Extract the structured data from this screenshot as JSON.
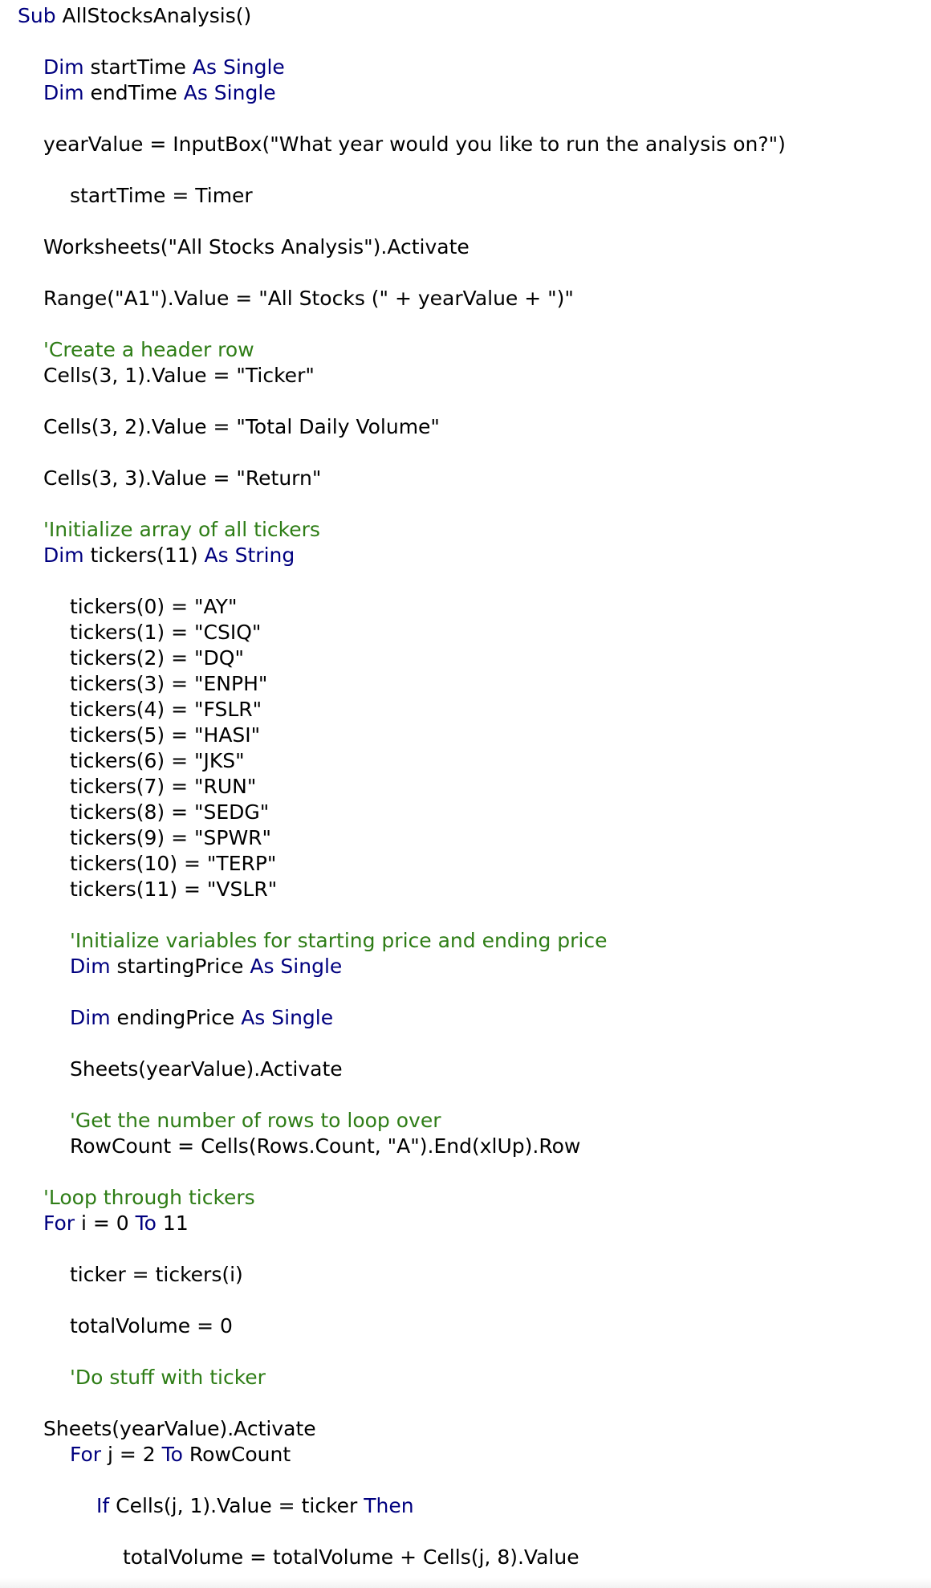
{
  "colors": {
    "background": "#ffffff",
    "keyword": "#00007f",
    "comment": "#2e7d16",
    "text": "#000000"
  },
  "lines": [
    [
      {
        "t": "Sub",
        "c": "kw"
      },
      {
        "t": " AllStocksAnalysis()",
        "c": "tx"
      }
    ],
    [
      {
        "t": "Dim",
        "c": "kw"
      },
      {
        "t": " startTime ",
        "c": "tx"
      },
      {
        "t": "As Single",
        "c": "kw"
      }
    ],
    [
      {
        "t": "Dim",
        "c": "kw"
      },
      {
        "t": " endTime ",
        "c": "tx"
      },
      {
        "t": "As Single",
        "c": "kw"
      }
    ],
    [
      {
        "t": "yearValue = InputBox(\"What year would you like to run the analysis on?\")",
        "c": "tx"
      }
    ],
    [
      {
        "t": "startTime = Timer",
        "c": "tx"
      }
    ],
    [
      {
        "t": "Worksheets(\"All Stocks Analysis\").Activate",
        "c": "tx"
      }
    ],
    [
      {
        "t": "Range(\"A1\").Value = \"All Stocks (\" + yearValue + \")\"",
        "c": "tx"
      }
    ],
    [
      {
        "t": "'Create a header row",
        "c": "cm"
      }
    ],
    [
      {
        "t": "Cells(3, 1).Value = \"Ticker\"",
        "c": "tx"
      }
    ],
    [
      {
        "t": "Cells(3, 2).Value = \"Total Daily Volume\"",
        "c": "tx"
      }
    ],
    [
      {
        "t": "Cells(3, 3).Value = \"Return\"",
        "c": "tx"
      }
    ],
    [
      {
        "t": "'Initialize array of all tickers",
        "c": "cm"
      }
    ],
    [
      {
        "t": "Dim",
        "c": "kw"
      },
      {
        "t": " tickers(11) ",
        "c": "tx"
      },
      {
        "t": "As String",
        "c": "kw"
      }
    ],
    [
      {
        "t": "tickers(0) = \"AY\"",
        "c": "tx"
      }
    ],
    [
      {
        "t": "tickers(1) = \"CSIQ\"",
        "c": "tx"
      }
    ],
    [
      {
        "t": "tickers(2) = \"DQ\"",
        "c": "tx"
      }
    ],
    [
      {
        "t": "tickers(3) = \"ENPH\"",
        "c": "tx"
      }
    ],
    [
      {
        "t": "tickers(4) = \"FSLR\"",
        "c": "tx"
      }
    ],
    [
      {
        "t": "tickers(5) = \"HASI\"",
        "c": "tx"
      }
    ],
    [
      {
        "t": "tickers(6) = \"JKS\"",
        "c": "tx"
      }
    ],
    [
      {
        "t": "tickers(7) = \"RUN\"",
        "c": "tx"
      }
    ],
    [
      {
        "t": "tickers(8) = \"SEDG\"",
        "c": "tx"
      }
    ],
    [
      {
        "t": "tickers(9) = \"SPWR\"",
        "c": "tx"
      }
    ],
    [
      {
        "t": "tickers(10) = \"TERP\"",
        "c": "tx"
      }
    ],
    [
      {
        "t": "tickers(11) = \"VSLR\"",
        "c": "tx"
      }
    ],
    [
      {
        "t": "'Initialize variables for starting price and ending price",
        "c": "cm"
      }
    ],
    [
      {
        "t": "Dim",
        "c": "kw"
      },
      {
        "t": " startingPrice ",
        "c": "tx"
      },
      {
        "t": "As Single",
        "c": "kw"
      }
    ],
    [
      {
        "t": "Dim",
        "c": "kw"
      },
      {
        "t": " endingPrice ",
        "c": "tx"
      },
      {
        "t": "As Single",
        "c": "kw"
      }
    ],
    [
      {
        "t": "Sheets(yearValue).Activate",
        "c": "tx"
      }
    ],
    [
      {
        "t": "'Get the number of rows to loop over",
        "c": "cm"
      }
    ],
    [
      {
        "t": "RowCount = Cells(Rows.Count, \"A\").End(xlUp).Row",
        "c": "tx"
      }
    ],
    [
      {
        "t": "'Loop through tickers",
        "c": "cm"
      }
    ],
    [
      {
        "t": "For",
        "c": "kw"
      },
      {
        "t": " i = 0 ",
        "c": "tx"
      },
      {
        "t": "To",
        "c": "kw"
      },
      {
        "t": " 11",
        "c": "tx"
      }
    ],
    [
      {
        "t": "ticker = tickers(i)",
        "c": "tx"
      }
    ],
    [
      {
        "t": "totalVolume = 0",
        "c": "tx"
      }
    ],
    [
      {
        "t": "'Do stuff with ticker",
        "c": "cm"
      }
    ],
    [
      {
        "t": "Sheets(yearValue).Activate",
        "c": "tx"
      }
    ],
    [
      {
        "t": "For",
        "c": "kw"
      },
      {
        "t": " j = 2 ",
        "c": "tx"
      },
      {
        "t": "To",
        "c": "kw"
      },
      {
        "t": " RowCount",
        "c": "tx"
      }
    ],
    [
      {
        "t": "If",
        "c": "kw"
      },
      {
        "t": " Cells(j, 1).Value = ticker ",
        "c": "tx"
      },
      {
        "t": "Then",
        "c": "kw"
      }
    ],
    [
      {
        "t": "totalVolume = totalVolume + Cells(j, 8).Value",
        "c": "tx"
      }
    ]
  ]
}
